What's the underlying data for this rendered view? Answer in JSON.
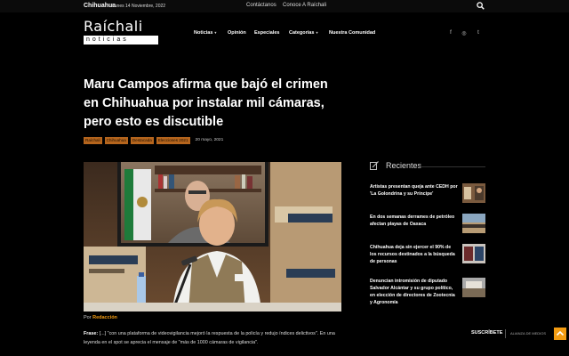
{
  "topbar": {
    "city": "Chihuahua",
    "date": "Lunes 14 Noviembre, 2022",
    "links": [
      "Contáctanos",
      "Conoce A Raíchali"
    ],
    "search_icon": "search-icon"
  },
  "header": {
    "logo_word": "Raíchali",
    "logo_sub": "noticias",
    "nav": [
      {
        "label": "Noticias",
        "has_dropdown": true
      },
      {
        "label": "Opinión",
        "has_dropdown": false
      },
      {
        "label": "Especiales",
        "has_dropdown": false
      },
      {
        "label": "Categorías",
        "has_dropdown": true
      },
      {
        "label": "Nuestra Comunidad",
        "has_dropdown": false
      }
    ],
    "caret": "▾",
    "social": [
      {
        "icon": "facebook-icon",
        "glyph": "f"
      },
      {
        "icon": "instagram-icon",
        "glyph": "◎"
      },
      {
        "icon": "twitter-icon",
        "glyph": "t"
      }
    ]
  },
  "article": {
    "title": "Maru Campos afirma que bajó el crimen en Chihuahua por instalar mil cámaras, pero esto es discutible",
    "tags": [
      "Raíchali",
      "Chihuahua",
      "Destacada",
      "Elecciones 2021"
    ],
    "date": "20 mayo, 2021",
    "byline_prefix": "Por",
    "author": "Redacción",
    "excerpt_label": "Frase:",
    "excerpt_text": "[...] \"con una plataforma de videovigilancia mejoró la respuesta de la policía y redujo índices delictivos\". En una leyenda en el spot se aprecia el mensaje de \"más de 1000 cámaras de vigilancia\"."
  },
  "sidebar": {
    "title": "Recientes",
    "items": [
      {
        "text": "Artistas presentan queja ante CEDH por 'La Golondrina y su Príncipe'"
      },
      {
        "text": "En dos semanas derrames de petróleo afectan playas de Oaxaca"
      },
      {
        "text": "Chihuahua deja sin ejercer el 90% de los recursos destinados a la búsqueda de personas"
      },
      {
        "text": "Denuncian intromisión de diputado Salvador Alcántar y su grupo político, en elección de directores de Zootecnia y Agronomía"
      }
    ]
  },
  "subscribe": {
    "label": "SUSCRÍBETE",
    "alliance": "ALIANZA DE MEDIOS"
  },
  "colors": {
    "accent": "#f39c12",
    "tag_bg": "#b5651d",
    "background": "#000000"
  }
}
